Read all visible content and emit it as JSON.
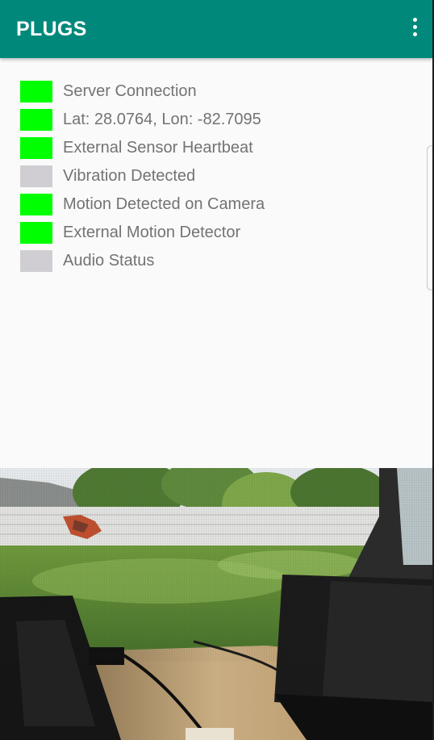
{
  "app_bar": {
    "title": "PLUGS",
    "menu_icon": "more-vert-icon",
    "color": "#00897b"
  },
  "status_items": [
    {
      "label": "Server Connection",
      "active": true
    },
    {
      "label": "Lat: 28.0764, Lon: -82.7095",
      "active": true
    },
    {
      "label": "External Sensor Heartbeat",
      "active": true
    },
    {
      "label": "Vibration Detected",
      "active": false
    },
    {
      "label": "Motion Detected on Camera",
      "active": true
    },
    {
      "label": "External Motion Detector",
      "active": true
    },
    {
      "label": "Audio Status",
      "active": false
    }
  ],
  "colors": {
    "active": "#00ff00",
    "inactive": "#d0ced2",
    "label_text": "#737373",
    "background": "#fafafa"
  }
}
